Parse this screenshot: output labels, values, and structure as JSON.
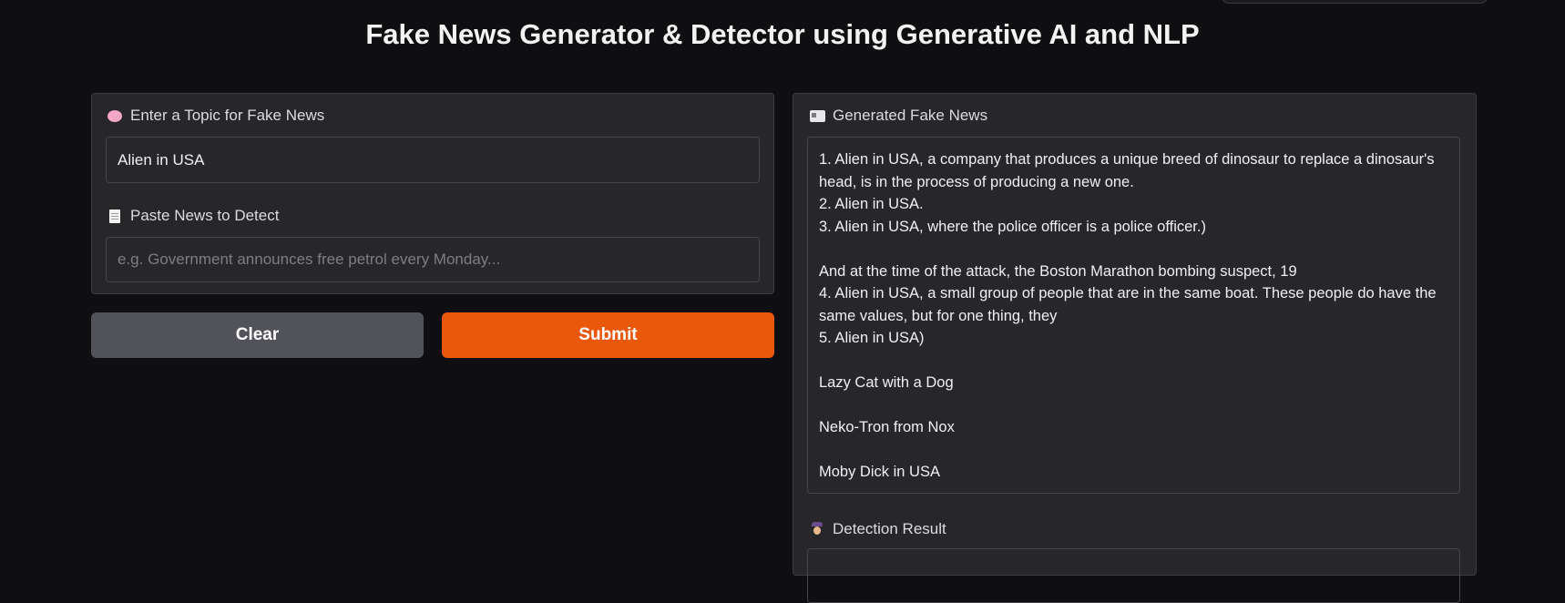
{
  "page": {
    "title": "Fake News Generator & Detector using Generative AI and NLP"
  },
  "left": {
    "topic_label": "Enter a Topic for Fake News",
    "topic_icon": "brain-icon",
    "topic_value": "Alien in USA",
    "detect_label": "Paste News to Detect",
    "detect_icon": "page-icon",
    "detect_placeholder": "e.g. Government announces free petrol every Monday...",
    "clear_label": "Clear",
    "submit_label": "Submit"
  },
  "right": {
    "generated_label": "Generated Fake News",
    "generated_icon": "newspaper-icon",
    "generated_text": "1. Alien in USA, a company that produces a unique breed of dinosaur to replace a dinosaur's head, is in the process of producing a new one.\n2. Alien in USA.\n3. Alien in USA, where the police officer is a police officer.)\n\nAnd at the time of the attack, the Boston Marathon bombing suspect, 19\n4. Alien in USA, a small group of people that are in the same boat. These people do have the same values, but for one thing, they\n5. Alien in USA)\n\nLazy Cat with a Dog\n\nNeko-Tron from Nox\n\nMoby Dick in USA",
    "result_label": "Detection Result",
    "result_icon": "detective-icon"
  },
  "colors": {
    "background": "#0f0f11",
    "panel": "#27272a",
    "submit": "#ea580c",
    "clear": "#52525b"
  }
}
